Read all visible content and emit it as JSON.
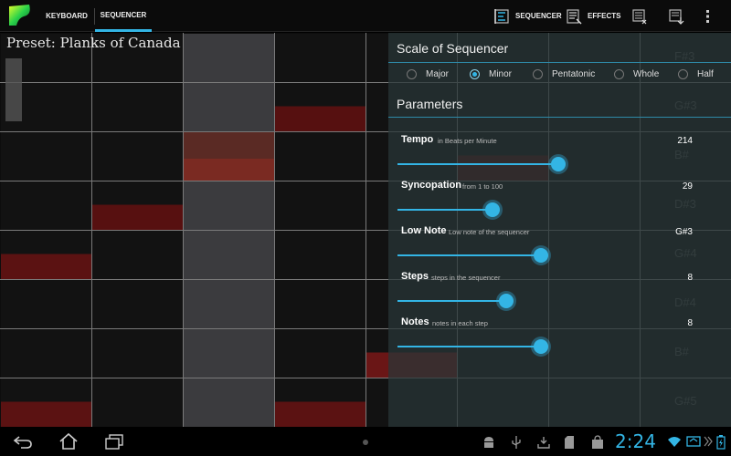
{
  "actionbar": {
    "tabs": [
      {
        "label": "KEYBOARD",
        "selected": false
      },
      {
        "label": "SEQUENCER",
        "selected": true
      }
    ],
    "actions": {
      "sequencer_label": "SEQUENCER",
      "effects_label": "EFFECTS"
    }
  },
  "preset": {
    "label": "Preset: Planks of Canada"
  },
  "grid": {
    "columns": 8,
    "rows": 8,
    "note_labels": [
      "F#3",
      "G#3",
      "B#",
      "D#3",
      "G#4",
      "D#4",
      "B#",
      "G#5"
    ]
  },
  "scale": {
    "title": "Scale of Sequencer",
    "options": [
      "Major",
      "Minor",
      "Pentatonic",
      "Whole",
      "Half"
    ],
    "selected": "Minor"
  },
  "parameters": {
    "title": "Parameters",
    "items": [
      {
        "name": "Tempo",
        "desc": "in Beats per Minute",
        "value": "214",
        "fraction": 0.56
      },
      {
        "name": "Syncopation",
        "desc": "from 1 to 100",
        "value": "29",
        "fraction": 0.33
      },
      {
        "name": "Low Note",
        "desc": "Low note of the sequencer",
        "value": "G#3",
        "fraction": 0.5
      },
      {
        "name": "Steps",
        "desc": "steps in the sequencer",
        "value": "8",
        "fraction": 0.38
      },
      {
        "name": "Notes",
        "desc": "notes in each step",
        "value": "8",
        "fraction": 0.5
      }
    ]
  },
  "status": {
    "clock": "2:24"
  },
  "colors": {
    "accent": "#33b5e5",
    "note_red": "#5a1212"
  }
}
